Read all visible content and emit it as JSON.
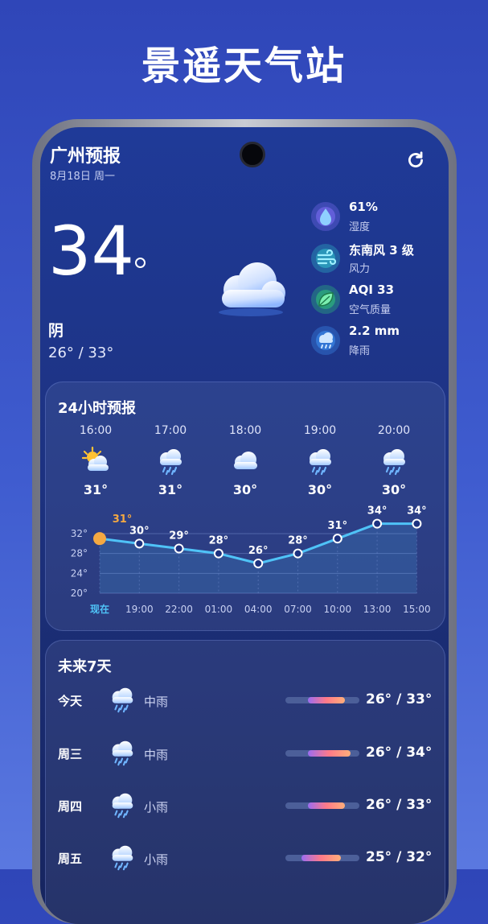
{
  "banner_title": "景遥天气站",
  "header": {
    "city": "广州预报",
    "date": "8月18日 周一",
    "refresh_icon": "refresh-icon"
  },
  "current": {
    "temp": "34",
    "condition": "阴",
    "range": "26° / 33°",
    "icon": "cloud-icon"
  },
  "stats": [
    {
      "value": "61%",
      "label": "湿度",
      "icon": "humidity-drop-icon",
      "color": "#7b6cf2"
    },
    {
      "value": "东南风 3 级",
      "label": "风力",
      "icon": "wind-icon",
      "color": "#2fb8c8"
    },
    {
      "value": "AQI 33",
      "label": "空气质量",
      "icon": "leaf-icon",
      "color": "#2ec07a"
    },
    {
      "value": "2.2 mm",
      "label": "降雨",
      "icon": "rain-cloud-icon",
      "color": "#3b8ef0"
    }
  ],
  "hourly": {
    "title": "24小时预报",
    "items": [
      {
        "time": "16:00",
        "temp": "31°",
        "icon": "partly-sunny-icon"
      },
      {
        "time": "17:00",
        "temp": "31°",
        "icon": "rain-icon"
      },
      {
        "time": "18:00",
        "temp": "30°",
        "icon": "cloud-icon"
      },
      {
        "time": "19:00",
        "temp": "30°",
        "icon": "rain-icon"
      },
      {
        "time": "20:00",
        "temp": "30°",
        "icon": "rain-icon"
      }
    ]
  },
  "chart_data": {
    "type": "line",
    "categories": [
      "现在",
      "19:00",
      "22:00",
      "01:00",
      "04:00",
      "07:00",
      "10:00",
      "13:00",
      "15:00"
    ],
    "values": [
      31,
      30,
      29,
      28,
      26,
      28,
      31,
      34,
      34
    ],
    "point_labels": [
      "31°",
      "30°",
      "29°",
      "28°",
      "26°",
      "28°",
      "31°",
      "34°",
      "34°"
    ],
    "y_ticks": [
      "32°",
      "28°",
      "24°",
      "20°"
    ],
    "ylim": [
      20,
      34
    ],
    "grid": true,
    "line_color": "#4fc3f7",
    "highlight_color": "#f5a942"
  },
  "daily": {
    "title": "未来7天",
    "items": [
      {
        "day": "今天",
        "condition": "中雨",
        "range": "26° / 33°",
        "bar_start": 0.3,
        "bar_end": 0.8
      },
      {
        "day": "周三",
        "condition": "中雨",
        "range": "26° / 34°",
        "bar_start": 0.3,
        "bar_end": 0.88
      },
      {
        "day": "周四",
        "condition": "小雨",
        "range": "26° / 33°",
        "bar_start": 0.3,
        "bar_end": 0.8
      },
      {
        "day": "周五",
        "condition": "小雨",
        "range": "25° / 32°",
        "bar_start": 0.22,
        "bar_end": 0.75
      }
    ]
  }
}
